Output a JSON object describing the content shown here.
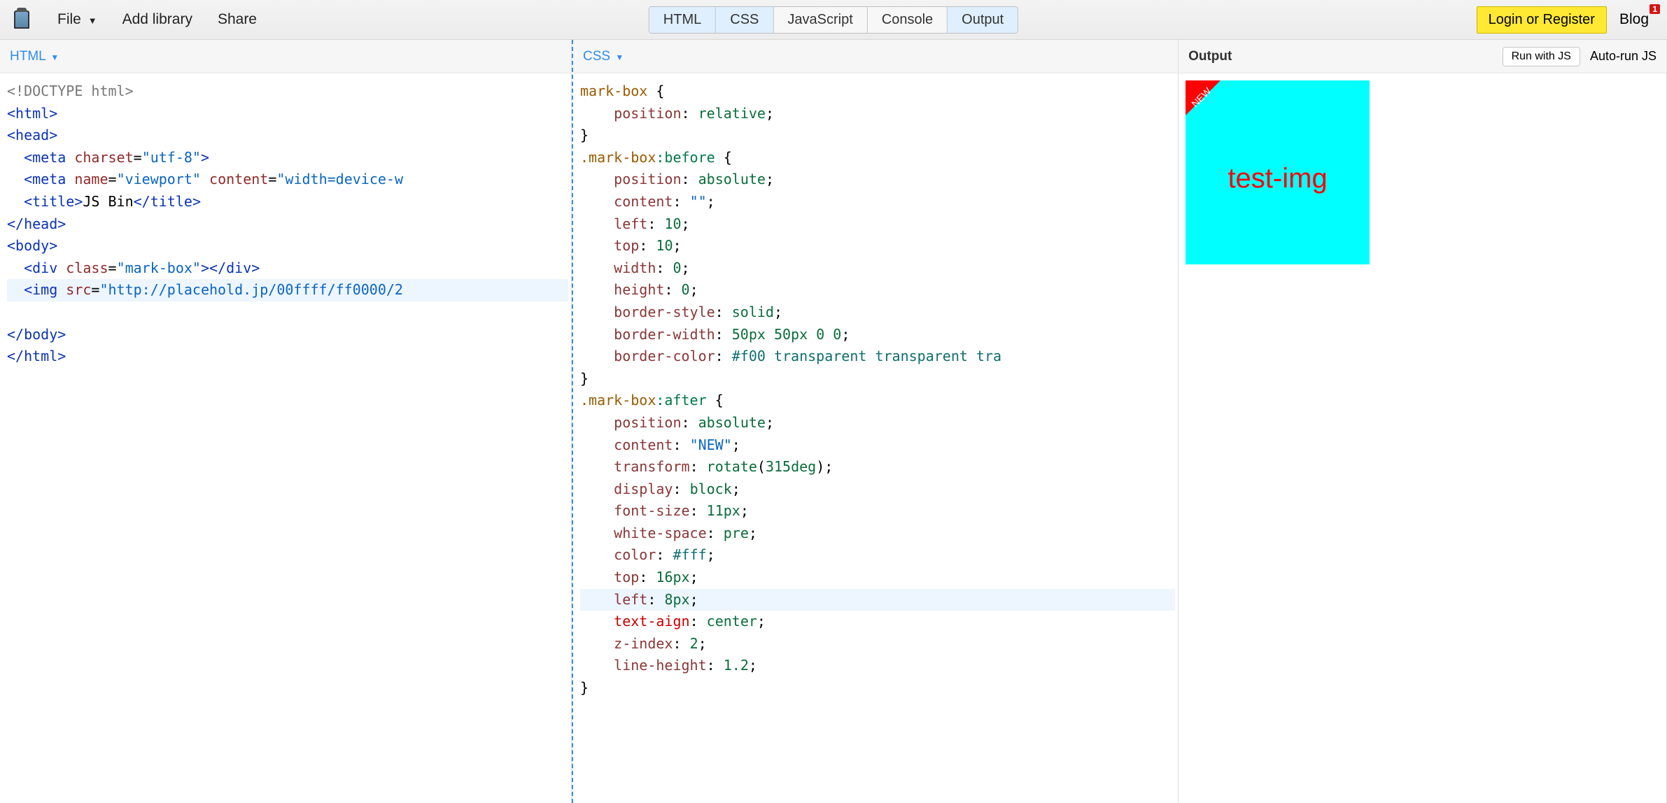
{
  "menu": {
    "file": "File",
    "addlib": "Add library",
    "share": "Share"
  },
  "tabs": {
    "html": "HTML",
    "css": "CSS",
    "js": "JavaScript",
    "console": "Console",
    "output": "Output"
  },
  "right": {
    "login": "Login or Register",
    "blog": "Blog",
    "blog_badge": "1"
  },
  "panel_labels": {
    "html": "HTML",
    "css": "CSS",
    "output": "Output",
    "runjs": "Run with JS",
    "autorun": "Auto-run JS"
  },
  "html_code": {
    "l1": "<!DOCTYPE html>",
    "l2a": "<",
    "l2b": "html",
    "l2c": ">",
    "l3a": "<",
    "l3b": "head",
    "l3c": ">",
    "l4a": "  <",
    "l4b": "meta",
    "l4c": " ",
    "l4d": "charset",
    "l4e": "=",
    "l4f": "\"utf-8\"",
    "l4g": ">",
    "l5a": "  <",
    "l5b": "meta",
    "l5c": " ",
    "l5d": "name",
    "l5e": "=",
    "l5f": "\"viewport\"",
    "l5g": " ",
    "l5h": "content",
    "l5i": "=",
    "l5j": "\"width=device-w",
    "l6a": "  <",
    "l6b": "title",
    "l6c": ">",
    "l6d": "JS Bin",
    "l6e": "</",
    "l6f": "title",
    "l6g": ">",
    "l7a": "</",
    "l7b": "head",
    "l7c": ">",
    "l8a": "<",
    "l8b": "body",
    "l8c": ">",
    "l9a": "  <",
    "l9b": "div",
    "l9c": " ",
    "l9d": "class",
    "l9e": "=",
    "l9f": "\"mark-box\"",
    "l9g": "></",
    "l9h": "div",
    "l9i": ">",
    "l10a": "  <",
    "l10b": "img",
    "l10c": " ",
    "l10d": "src",
    "l10e": "=",
    "l10f": "\"http://placehold.jp/00ffff/ff0000/2",
    "l12a": "</",
    "l12b": "body",
    "l12c": ">",
    "l13a": "</",
    "l13b": "html",
    "l13c": ">"
  },
  "css_code": {
    "s1": "mark-box",
    "b1": " {",
    "p1": "    position",
    "col": ": ",
    "v1": "relative",
    "sc": ";",
    "cb": "}",
    "s2": ".mark-box",
    "ps2": ":before",
    "b2": " {",
    "p2": "    position",
    "v2": "absolute",
    "p3": "    content",
    "v3": "\"\"",
    "p4": "    left",
    "v4": "10",
    "p5": "    top",
    "v5": "10",
    "p6": "    width",
    "v6": "0",
    "p7": "    height",
    "v7": "0",
    "p8": "    border-style",
    "v8": "solid",
    "p9": "    border-width",
    "v9": "50px 50px 0 0",
    "p10": "    border-color",
    "v10": "#f00 transparent transparent tra",
    "s3": ".mark-box",
    "ps3": ":after",
    "b3": " {",
    "p11": "    position",
    "v11": "absolute",
    "p12": "    content",
    "v12": "\"NEW\"",
    "p13": "    transform",
    "v13a": "rotate",
    "v13b": "(",
    "v13c": "315deg",
    "v13d": ")",
    "p14": "    display",
    "v14": "block",
    "p15": "    font-size",
    "v15": "11px",
    "p16": "    white-space",
    "v16": "pre",
    "p17": "    color",
    "v17": "#fff",
    "p18": "    top",
    "v18": "16px",
    "p19": "    left",
    "v19": "8px",
    "p20": "    text-aign",
    "v20": "center",
    "p21": "    z-index",
    "v21": "2",
    "p22": "    line-height",
    "v22": "1.2"
  },
  "output": {
    "new": "NEW",
    "text": "test-img"
  }
}
